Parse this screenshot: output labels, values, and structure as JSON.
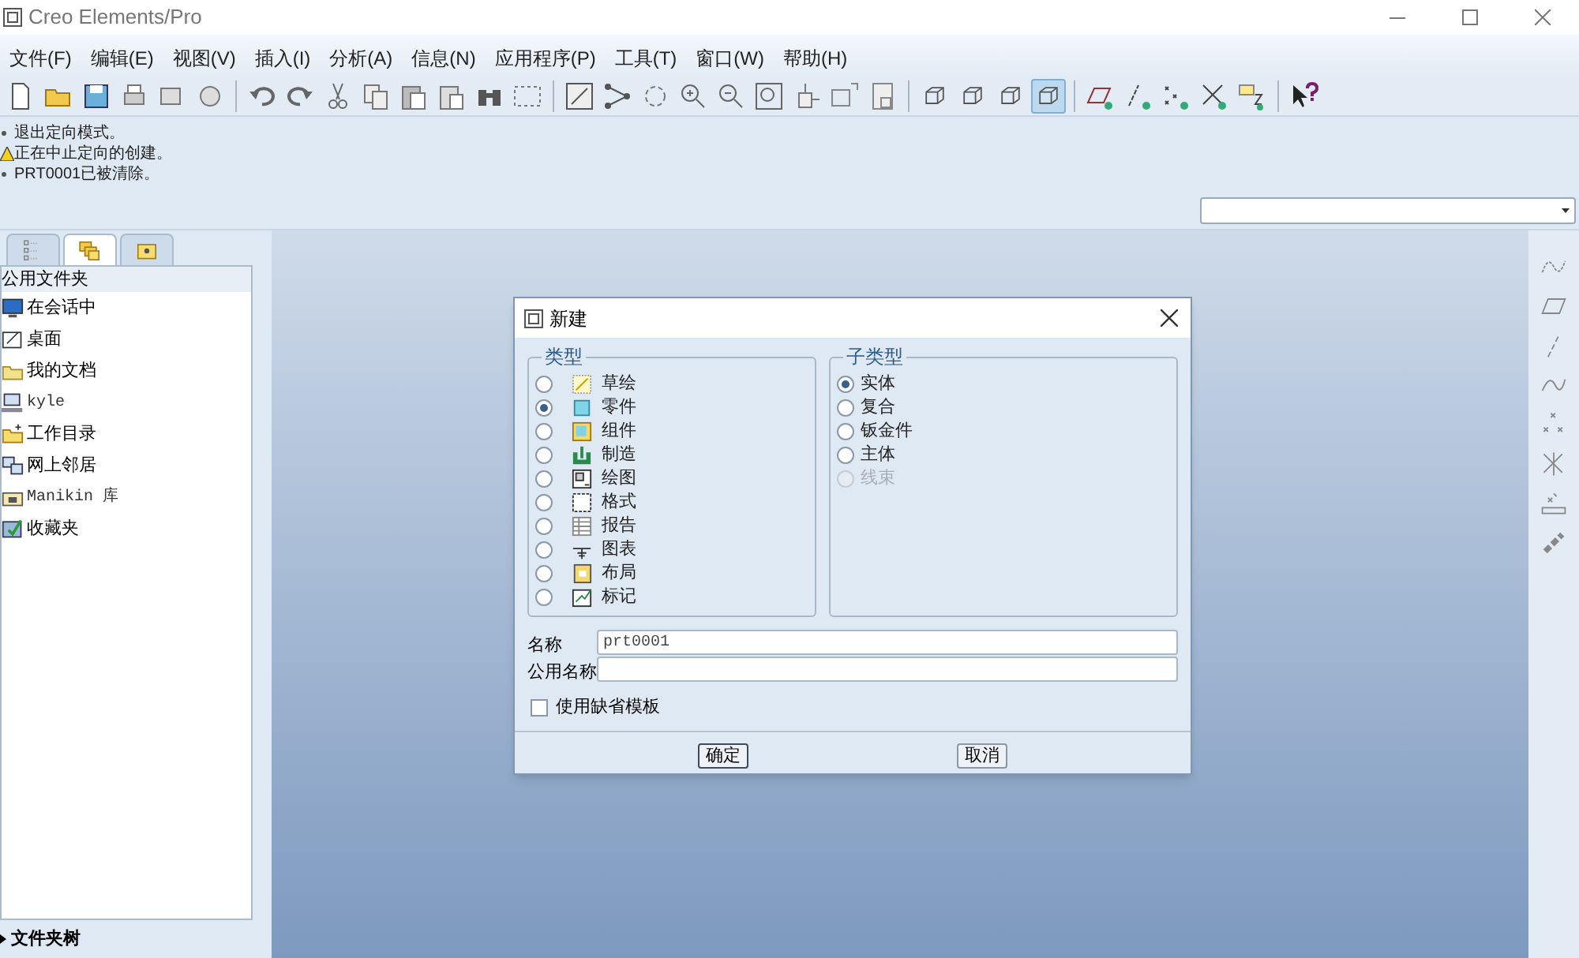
{
  "window": {
    "title": "Creo Elements/Pro"
  },
  "menu": [
    "文件(F)",
    "编辑(E)",
    "视图(V)",
    "插入(I)",
    "分析(A)",
    "信息(N)",
    "应用程序(P)",
    "工具(T)",
    "窗口(W)",
    "帮助(H)"
  ],
  "display_styles": [
    {
      "selected": false
    },
    {
      "selected": false
    },
    {
      "selected": false
    },
    {
      "selected": true
    }
  ],
  "messages": [
    {
      "kind": "info",
      "text": "退出定向模式。"
    },
    {
      "kind": "warning",
      "text": "正在中止定向的创建。"
    },
    {
      "kind": "info",
      "text": "PRT0001已被清除。"
    }
  ],
  "navigator": {
    "tabs": [
      {
        "selected": false
      },
      {
        "selected": true
      },
      {
        "selected": false
      }
    ],
    "header": "公用文件夹",
    "items": [
      {
        "kind": "session",
        "label": "在会话中"
      },
      {
        "kind": "desktop",
        "label": "桌面"
      },
      {
        "kind": "documents",
        "label": "我的文档"
      },
      {
        "kind": "computer",
        "label": "kyle"
      },
      {
        "kind": "workdir",
        "label": "工作目录"
      },
      {
        "kind": "network",
        "label": "网上邻居"
      },
      {
        "kind": "library",
        "label": "Manikin 库"
      },
      {
        "kind": "favorites",
        "label": "收藏夹"
      }
    ],
    "footer": "文件夹树"
  },
  "dialog": {
    "title": "新建",
    "type_group": {
      "title": "类型",
      "options": [
        {
          "label": "草绘",
          "selected": false
        },
        {
          "label": "零件",
          "selected": true
        },
        {
          "label": "组件",
          "selected": false
        },
        {
          "label": "制造",
          "selected": false
        },
        {
          "label": "绘图",
          "selected": false
        },
        {
          "label": "格式",
          "selected": false
        },
        {
          "label": "报告",
          "selected": false
        },
        {
          "label": "图表",
          "selected": false
        },
        {
          "label": "布局",
          "selected": false
        },
        {
          "label": "标记",
          "selected": false
        }
      ]
    },
    "subtype_group": {
      "title": "子类型",
      "options": [
        {
          "label": "实体",
          "selected": true,
          "disabled": false
        },
        {
          "label": "复合",
          "selected": false,
          "disabled": false
        },
        {
          "label": "钣金件",
          "selected": false,
          "disabled": false
        },
        {
          "label": "主体",
          "selected": false,
          "disabled": false
        },
        {
          "label": "线束",
          "selected": false,
          "disabled": true
        }
      ]
    },
    "name_label": "名称",
    "name_value": "prt0001",
    "common_name_label": "公用名称",
    "use_default_template": {
      "label": "使用缺省模板",
      "checked": false
    },
    "buttons": [
      "确定",
      "取消"
    ]
  }
}
